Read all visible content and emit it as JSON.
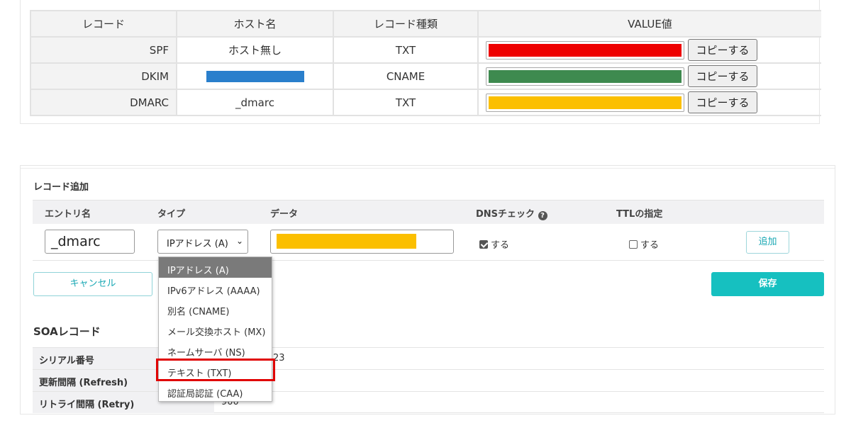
{
  "dns_table": {
    "headers": [
      "レコード",
      "ホスト名",
      "レコード種類",
      "VALUE値"
    ],
    "copy_label": "コピーする",
    "rows": [
      {
        "label": "SPF",
        "host": "ホスト無し",
        "type": "TXT",
        "value_color": "#ee0000"
      },
      {
        "label": "DKIM",
        "host": "",
        "host_redaction_color": "#2a7fcc",
        "type": "CNAME",
        "value_color": "#3e8a4f"
      },
      {
        "label": "DMARC",
        "host": "_dmarc",
        "type": "TXT",
        "value_color": "#fbbf00"
      }
    ]
  },
  "record_add": {
    "title": "レコード追加",
    "columns": {
      "entry": "エントリ名",
      "type": "タイプ",
      "data": "データ",
      "dns_check": "DNSチェック",
      "ttl": "TTLの指定"
    },
    "help_icon": "question-circle-icon",
    "entry_value": "_dmarc",
    "type_selected": "IPアドレス (A)",
    "data_redaction_color": "#fbbf00",
    "dns_check": {
      "label": "する",
      "checked": true
    },
    "ttl": {
      "label": "する",
      "checked": false
    },
    "add_label": "追加",
    "cancel_label": "キャンセル",
    "save_label": "保存"
  },
  "type_options": [
    "IPアドレス (A)",
    "IPv6アドレス (AAAA)",
    "別名 (CNAME)",
    "メール交換ホスト (MX)",
    "ネームサーバ (NS)",
    "テキスト (TXT)",
    "認証局認証 (CAA)"
  ],
  "highlighted_option": "テキスト (TXT)",
  "soa": {
    "title": "SOAレコード",
    "rows": [
      {
        "key": "シリアル番号",
        "value": "23"
      },
      {
        "key": "更新間隔 (Refresh)",
        "value": ""
      },
      {
        "key": "リトライ間隔 (Retry)",
        "value": "900"
      }
    ]
  }
}
